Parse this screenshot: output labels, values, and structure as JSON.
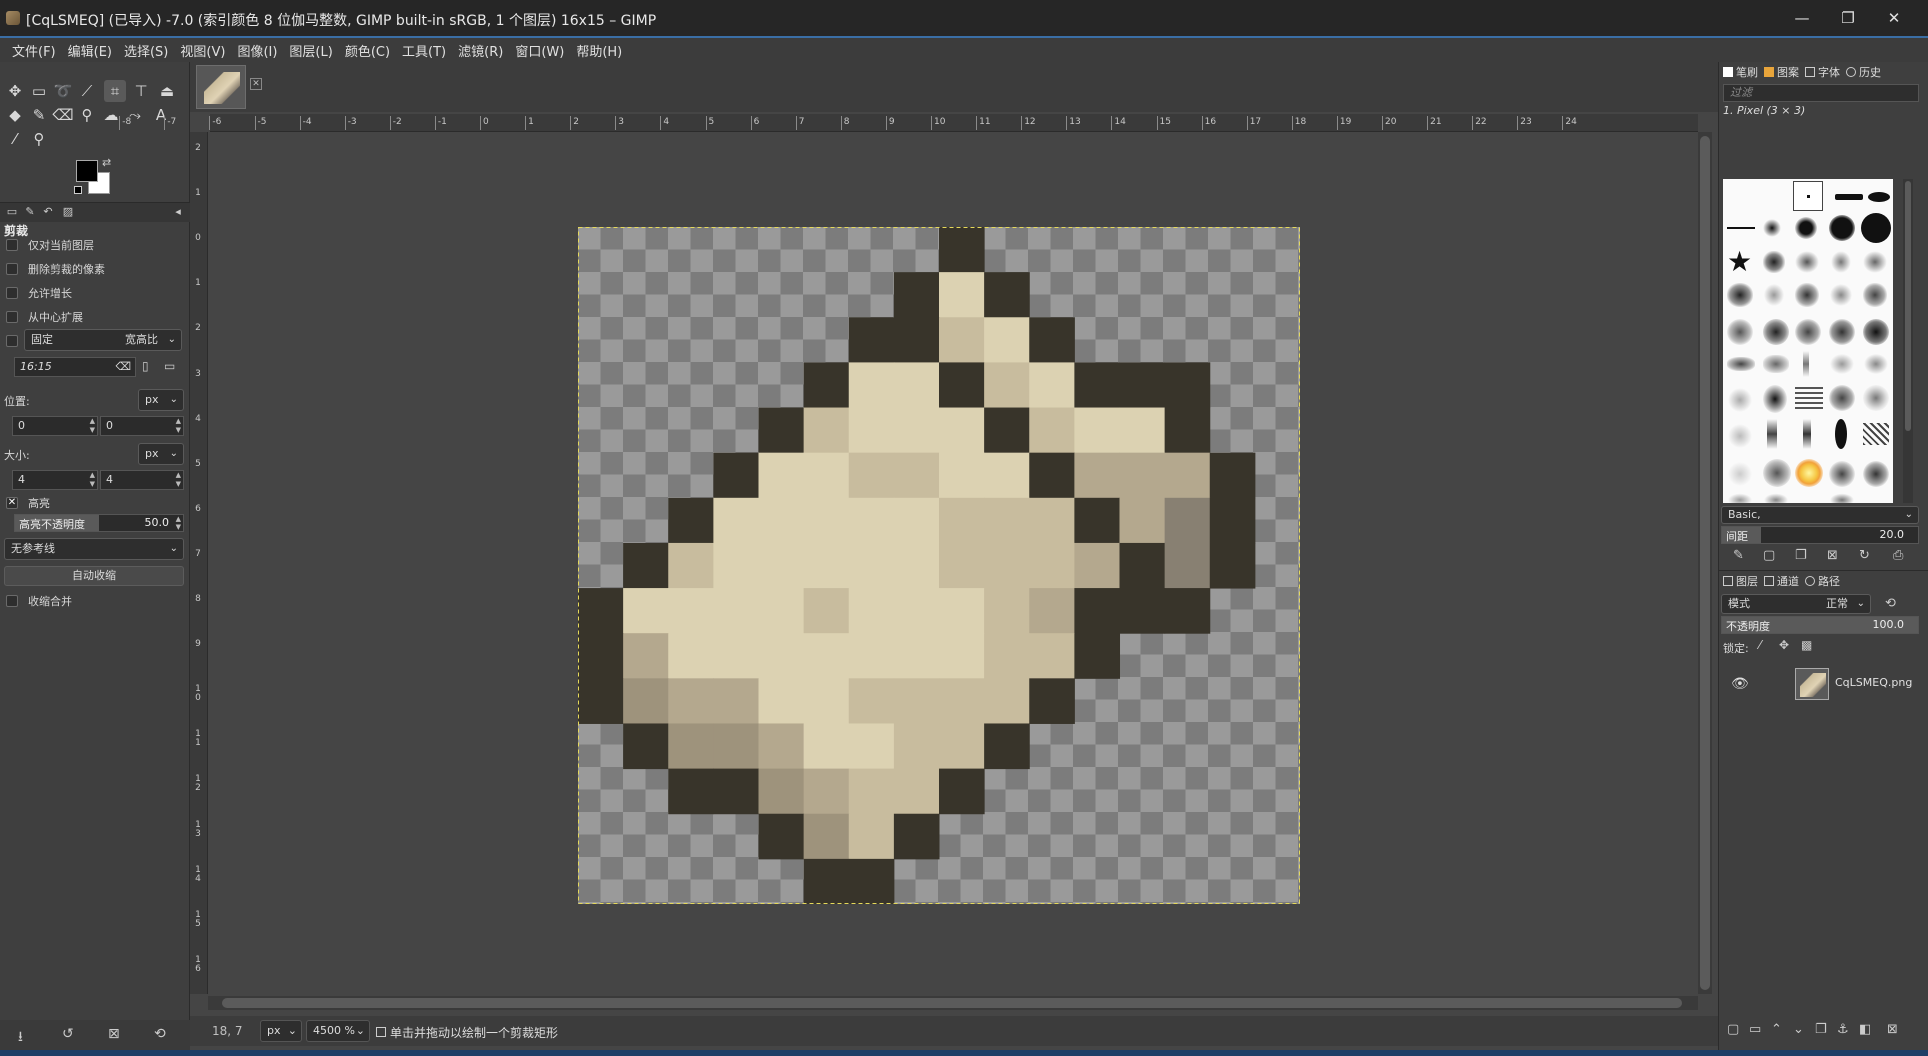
{
  "window": {
    "title": "[CqLSMEQ] (已导入) -7.0 (索引颜色 8 位伽马整数, GIMP built-in sRGB, 1 个图层) 16x15 – GIMP",
    "minimize": "—",
    "maximize": "❐",
    "close": "✕"
  },
  "menu": [
    "文件(F)",
    "编辑(E)",
    "选择(S)",
    "视图(V)",
    "图像(I)",
    "图层(L)",
    "颜色(C)",
    "工具(T)",
    "滤镜(R)",
    "窗口(W)",
    "帮助(H)"
  ],
  "tool_options": {
    "title": "剪裁",
    "current_layer_only": "仅对当前图层",
    "delete_cropped": "删除剪裁的像素",
    "allow_growing": "允许增长",
    "expand_from_center": "从中心扩展",
    "fixed_label": "固定",
    "fixed_mode": "宽高比",
    "ratio_value": "16:15",
    "position_label": "位置:",
    "position_unit": "px",
    "pos_x": "0",
    "pos_y": "0",
    "size_label": "大小:",
    "size_unit": "px",
    "size_w": "4",
    "size_h": "4",
    "highlight_label": "高亮",
    "highlight_opacity_label": "高亮不透明度",
    "highlight_opacity_value": "50.0",
    "highlight_opacity_fraction": 0.5,
    "guides": "无参考线",
    "auto_shrink": "自动收缩",
    "shrink_merged": "收缩合并"
  },
  "status": {
    "coords": "18, 7",
    "unit": "px",
    "zoom": "4500 %",
    "message": "单击并拖动以绘制一个剪裁矩形"
  },
  "rulers": {
    "h_ticks": [
      "-8",
      "-7",
      "-6",
      "-5",
      "-4",
      "-3",
      "-2",
      "-1",
      "0",
      "1",
      "2",
      "3",
      "4",
      "5",
      "6",
      "7",
      "8",
      "9",
      "10",
      "11",
      "12",
      "13",
      "14",
      "15",
      "16",
      "17",
      "18",
      "19",
      "20",
      "21",
      "22",
      "23",
      "24"
    ],
    "v_ticks": [
      "2",
      "1",
      "0",
      "1",
      "2",
      "3",
      "4",
      "5",
      "6",
      "7",
      "8",
      "9",
      "10",
      "11",
      "12",
      "13",
      "14",
      "15",
      "16"
    ]
  },
  "brushes_panel": {
    "tabs": [
      "笔刷",
      "图案",
      "字体",
      "历史"
    ],
    "filter_placeholder": "过滤",
    "selected_brush": "1. Pixel (3 × 3)",
    "preset": "Basic,",
    "spacing_label": "间距",
    "spacing_value": "20.0"
  },
  "layers_panel": {
    "tabs": [
      "图层",
      "通道",
      "路径"
    ],
    "mode_label": "模式",
    "mode_value": "正常",
    "opacity_label": "不透明度",
    "opacity_value": "100.0",
    "lock_label": "锁定:",
    "layer_name": "CqLSMEQ.png"
  },
  "colors": {
    "outline": "#38342a",
    "light": "#dcd2b2",
    "mid": "#c8bc9e",
    "shade": "#b4a88e",
    "dark_shade": "#9e937c",
    "grey": "#888072"
  },
  "sprite": {
    "width": 16,
    "height": 15,
    "rows": [
      "........O.......",
      ".......OLO......",
      "......OOMLO.....",
      ".....OLLOMLOOO..",
      "....OMLLLOMLLO..",
      "...OLLMMLLOSSSO.",
      "..OLLLLLMMMOSGO.",
      ".OMLLLLLMMMSOGO.",
      "OLLLLMLLLMSOOO..",
      "OSLLLLLLLMMO....",
      "OHSSLLMMMMO.....",
      ".OHHSLLMMO......",
      "..OOHSMMO.......",
      "....OHMO........",
      ".....OO........."
    ]
  }
}
